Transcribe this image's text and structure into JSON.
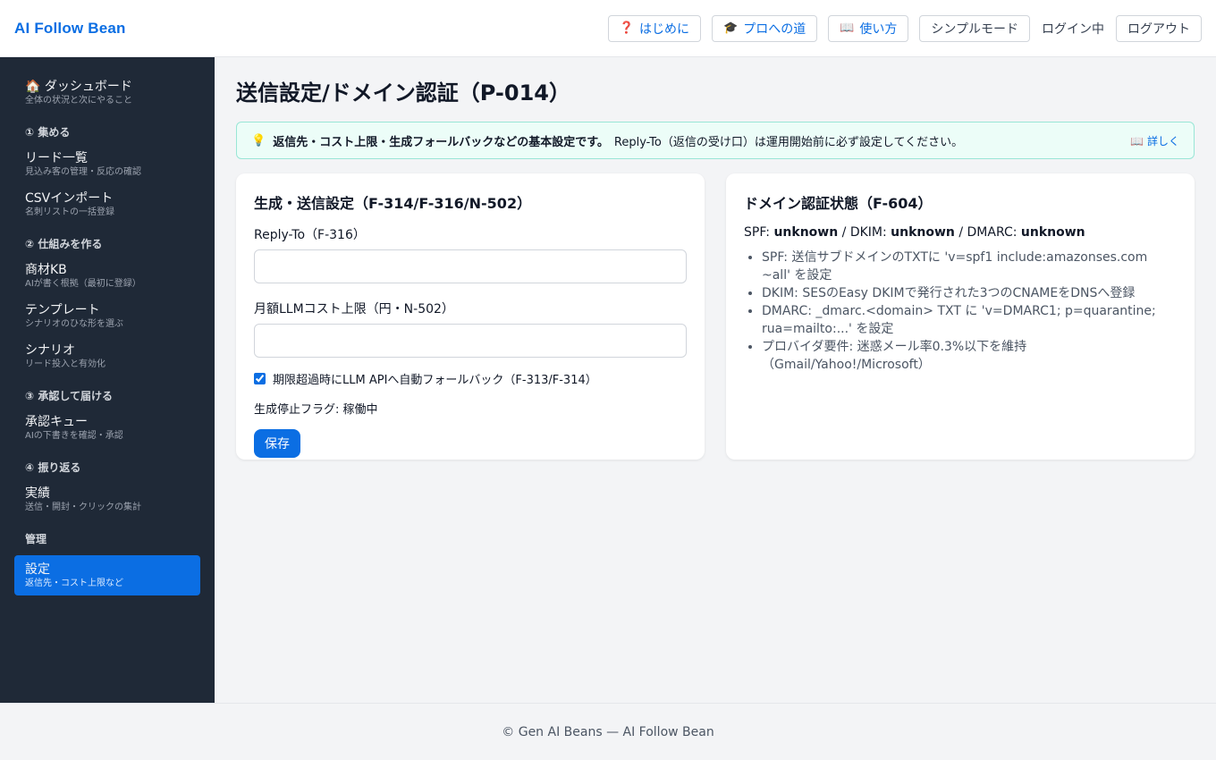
{
  "app": {
    "brand": "AI Follow Bean"
  },
  "header": {
    "buttons": [
      {
        "icon": "❓",
        "label": "はじめに"
      },
      {
        "icon": "🎓",
        "label": "プロへの道"
      },
      {
        "icon": "📖",
        "label": "使い方"
      }
    ],
    "simple_mode": "シンプルモード",
    "login_status": "ログイン中",
    "logout": "ログアウト"
  },
  "sidebar": {
    "dashboard": {
      "label": "🏠 ダッシュボード",
      "sub": "全体の状況と次にやること"
    },
    "section1": "① 集める",
    "leads": {
      "label": "リード一覧",
      "sub": "見込み客の管理・反応の確認"
    },
    "csv": {
      "label": "CSVインポート",
      "sub": "名刺リストの一括登録"
    },
    "section2": "② 仕組みを作る",
    "kb": {
      "label": "商材KB",
      "sub": "AIが書く根拠（最初に登録）"
    },
    "template": {
      "label": "テンプレート",
      "sub": "シナリオのひな形を選ぶ"
    },
    "scenario": {
      "label": "シナリオ",
      "sub": "リード投入と有効化"
    },
    "section3": "③ 承認して届ける",
    "queue": {
      "label": "承認キュー",
      "sub": "AIの下書きを確認・承認"
    },
    "section4": "④ 振り返る",
    "results": {
      "label": "実績",
      "sub": "送信・開封・クリックの集計"
    },
    "section5": "管理",
    "settings": {
      "label": "設定",
      "sub": "返信先・コスト上限など"
    }
  },
  "main": {
    "title": "送信設定/ドメイン認証（P-014）",
    "banner": {
      "icon": "💡",
      "strong": "返信先・コスト上限・生成フォールバックなどの基本設定です。",
      "text": "Reply-To（返信の受け口）は運用開始前に必ず設定してください。",
      "details": "📖 詳しく"
    },
    "send_settings": {
      "title": "生成・送信設定（F-314/F-316/N-502）",
      "reply_to_label": "Reply-To（F-316）",
      "reply_to_value": "",
      "cost_label": "月額LLMコスト上限（円・N-502）",
      "cost_value": "",
      "fallback_label": "期限超過時にLLM APIへ自動フォールバック（F-313/F-314）",
      "fallback_checked": true,
      "flag_text": "生成停止フラグ: 稼働中",
      "save": "保存"
    },
    "domain_auth": {
      "title": "ドメイン認証状態（F-604）",
      "spf_label": "SPF: ",
      "spf_value": "unknown",
      "dkim_label": " / DKIM: ",
      "dkim_value": "unknown",
      "dmarc_label": " / DMARC: ",
      "dmarc_value": "unknown",
      "items": [
        "SPF: 送信サブドメインのTXTに 'v=spf1 include:amazonses.com ~all' を設定",
        "DKIM: SESのEasy DKIMで発行された3つのCNAMEをDNSへ登録",
        "DMARC: _dmarc.<domain> TXT に 'v=DMARC1; p=quarantine; rua=mailto:...' を設定",
        "プロバイダ要件: 迷惑メール率0.3%以下を維持（Gmail/Yahoo!/Microsoft）"
      ]
    }
  },
  "footer": {
    "text": "© Gen AI Beans — AI Follow Bean"
  }
}
